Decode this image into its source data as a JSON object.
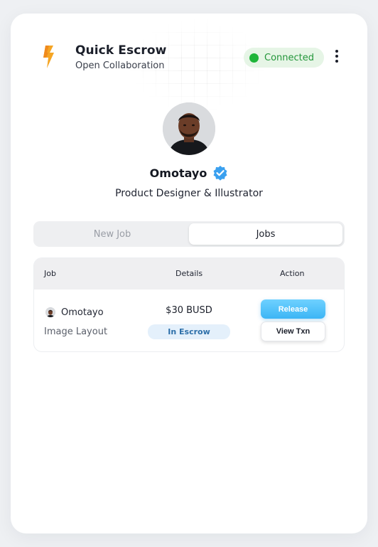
{
  "header": {
    "app_title": "Quick Escrow",
    "app_subtitle": "Open Collaboration",
    "logo_icon": "lightning-bolt-icon",
    "status": {
      "label": "Connected",
      "color": "#1fb53a"
    },
    "menu_icon": "kebab-menu-icon"
  },
  "profile": {
    "name": "Omotayo",
    "verified": true,
    "role": "Product Designer & Illustrator"
  },
  "tabs": [
    {
      "label": "New Job",
      "active": false
    },
    {
      "label": "Jobs",
      "active": true
    }
  ],
  "table": {
    "columns": [
      "Job",
      "Details",
      "Action"
    ],
    "rows": [
      {
        "user": "Omotayo",
        "job": "Image Layout",
        "amount": "$30 BUSD",
        "status": "In Escrow",
        "actions": [
          "Release",
          "View Txn"
        ]
      }
    ]
  },
  "colors": {
    "accent": "#3bb5f5",
    "logo": "#f5a524",
    "verified": "#3aa0ef"
  }
}
